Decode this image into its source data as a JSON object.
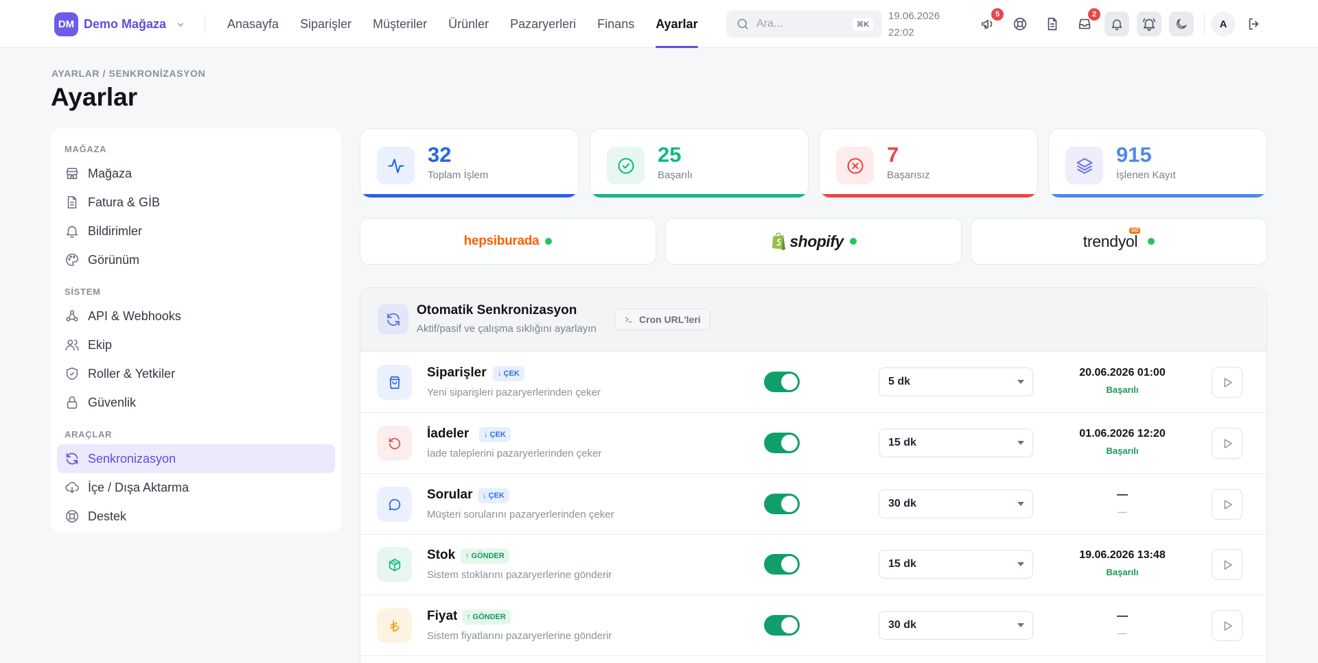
{
  "brand": {
    "initials": "DM",
    "name": "Demo Mağaza"
  },
  "nav": {
    "items": [
      "Anasayfa",
      "Siparişler",
      "Müşteriler",
      "Ürünler",
      "Pazaryerleri",
      "Finans",
      "Ayarlar"
    ],
    "active": "Ayarlar"
  },
  "search": {
    "placeholder": "Ara...",
    "shortcut": "⌘K"
  },
  "datetime": {
    "date": "19.06.2026",
    "time": "22:02"
  },
  "topbar_icons": [
    {
      "icon": "megaphone-icon",
      "badge": "5"
    },
    {
      "icon": "lifebuoy-icon",
      "badge": ""
    },
    {
      "icon": "document-icon",
      "badge": ""
    },
    {
      "icon": "inbox-icon",
      "badge": "2"
    },
    {
      "icon": "bell-icon",
      "badge": ""
    },
    {
      "icon": "bell-ring-icon",
      "badge": ""
    },
    {
      "icon": "moon-icon",
      "badge": ""
    }
  ],
  "user": {
    "initial": "A"
  },
  "breadcrumb": "AYARLAR / SENKRONİZASYON",
  "page_title": "Ayarlar",
  "sidebar": {
    "sections": [
      {
        "title": "MAĞAZA",
        "items": [
          {
            "label": "Mağaza",
            "icon": "store-icon"
          },
          {
            "label": "Fatura & GİB",
            "icon": "invoice-icon"
          },
          {
            "label": "Bildirimler",
            "icon": "bell-icon"
          },
          {
            "label": "Görünüm",
            "icon": "palette-icon"
          }
        ]
      },
      {
        "title": "SİSTEM",
        "items": [
          {
            "label": "API & Webhooks",
            "icon": "webhook-icon"
          },
          {
            "label": "Ekip",
            "icon": "users-icon"
          },
          {
            "label": "Roller & Yetkiler",
            "icon": "shield-icon"
          },
          {
            "label": "Güvenlik",
            "icon": "lock-icon"
          }
        ]
      },
      {
        "title": "ARAÇLAR",
        "items": [
          {
            "label": "Senkronizasyon",
            "icon": "sync-icon",
            "active": true
          },
          {
            "label": "İçe / Dışa Aktarma",
            "icon": "cloud-download-icon"
          },
          {
            "label": "Destek",
            "icon": "lifebuoy-icon"
          }
        ]
      }
    ]
  },
  "stats": [
    {
      "value": "32",
      "label": "Toplam İşlem",
      "color": "#2563eb",
      "bg": "#eaf0fd",
      "icon": "activity-icon"
    },
    {
      "value": "25",
      "label": "Başarılı",
      "color": "#10b981",
      "bg": "#e7f7f0",
      "icon": "check-circle-icon"
    },
    {
      "value": "7",
      "label": "Başarısız",
      "color": "#ef4444",
      "bg": "#fdecec",
      "icon": "x-circle-icon"
    },
    {
      "value": "915",
      "label": "İşlenen Kayıt",
      "color": "#4f8ae8",
      "bg": "#efedfb",
      "icon": "layers-icon"
    }
  ],
  "marketplaces": [
    {
      "name": "hepsiburada",
      "status_color": "#22c55e"
    },
    {
      "name": "shopify",
      "status_color": "#22c55e"
    },
    {
      "name": "trendyol",
      "tag": "GO",
      "status_color": "#22c55e"
    }
  ],
  "sync": {
    "title": "Otomatik Senkronizasyon",
    "subtitle": "Aktif/pasif ve çalışma sıklığını ayarlayın",
    "cron_button": "Cron URL'leri",
    "rows": [
      {
        "name": "Siparişler",
        "tag": "↓ ÇEK",
        "direction": "pull",
        "desc": "Yeni siparişleri pazaryerlerinden çeker",
        "enabled": true,
        "interval": "5 dk",
        "last_run": "20.06.2026 01:00",
        "last_status": "Başarılı",
        "icon": "shopping-bag-icon",
        "icon_color": "#2563eb",
        "icon_bg": "#eaf0fd"
      },
      {
        "name": "İadeler",
        "tag": "↓ ÇEK",
        "direction": "pull",
        "desc": "İade taleplerini pazaryerlerinden çeker",
        "enabled": true,
        "interval": "15 dk",
        "last_run": "01.06.2026 12:20",
        "last_status": "Başarılı",
        "icon": "undo-icon",
        "icon_color": "#e5484d",
        "icon_bg": "#fdeeee"
      },
      {
        "name": "Sorular",
        "tag": "↓ ÇEK",
        "direction": "pull",
        "desc": "Müşteri sorularını pazaryerlerinden çeker",
        "enabled": true,
        "interval": "30 dk",
        "last_run": "—",
        "last_status": "—",
        "icon": "chat-icon",
        "icon_color": "#2563eb",
        "icon_bg": "#eaf0fd"
      },
      {
        "name": "Stok",
        "tag": "↑ GÖNDER",
        "direction": "push",
        "desc": "Sistem stoklarını pazaryerlerine gönderir",
        "enabled": true,
        "interval": "15 dk",
        "last_run": "19.06.2026 13:48",
        "last_status": "Başarılı",
        "icon": "box-icon",
        "icon_color": "#10b981",
        "icon_bg": "#e7f7f0"
      },
      {
        "name": "Fiyat",
        "tag": "↑ GÖNDER",
        "direction": "push",
        "desc": "Sistem fiyatlarını pazaryerlerine gönderir",
        "enabled": true,
        "interval": "30 dk",
        "last_run": "—",
        "last_status": "—",
        "icon": "lira-icon",
        "icon_color": "#f59e0b",
        "icon_bg": "#fdf3e3"
      }
    ]
  }
}
